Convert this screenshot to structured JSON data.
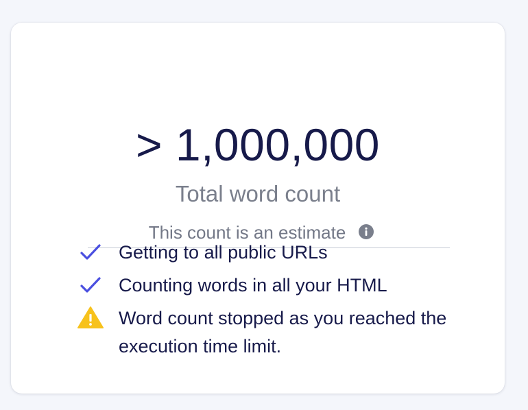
{
  "card": {
    "count": "> 1,000,000",
    "label": "Total word count",
    "estimate_note": "This count is an estimate",
    "info_icon": "info-icon"
  },
  "status": [
    {
      "icon": "check-icon",
      "text": "Getting to all public URLs"
    },
    {
      "icon": "check-icon",
      "text": "Counting words in all your HTML"
    },
    {
      "icon": "warning-icon",
      "text": "Word count stopped as you reached the execution time limit."
    }
  ],
  "colors": {
    "page_bg": "#f4f6fb",
    "card_bg": "#ffffff",
    "primary_text": "#171a4a",
    "muted_text": "#7a7f8c",
    "check": "#4a4fe0",
    "warning": "#f7c21c",
    "info": "#7a7f8c"
  }
}
